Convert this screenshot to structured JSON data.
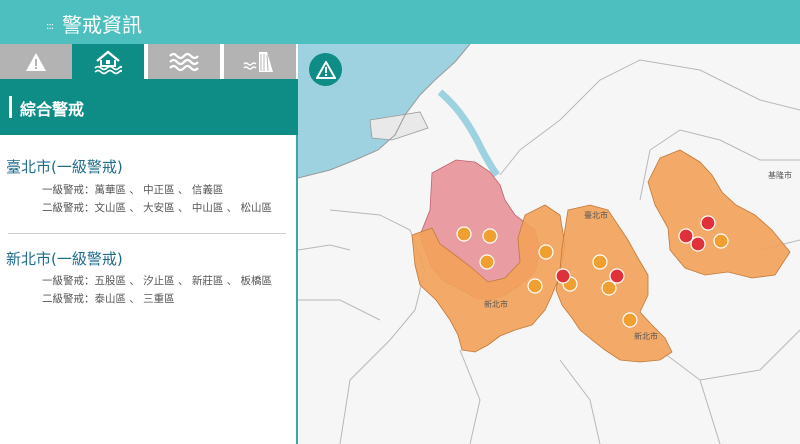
{
  "header": {
    "title": "警戒資訊",
    "menu_dots": ":::"
  },
  "tabs": [
    {
      "name": "alert",
      "icon": "warning-triangle-icon",
      "active": false
    },
    {
      "name": "flood",
      "icon": "flooded-house-icon",
      "active": true
    },
    {
      "name": "water",
      "icon": "water-waves-icon",
      "active": false
    },
    {
      "name": "reservoir",
      "icon": "dam-icon",
      "active": false
    }
  ],
  "section": {
    "title": "綜合警戒"
  },
  "cities": [
    {
      "name": "臺北市(一級警戒)",
      "level1": "一級警戒：萬華區 、 中正區 、 信義區",
      "level2": "二級警戒：文山區 、 大安區 、 中山區 、 松山區"
    },
    {
      "name": "新北市(一級警戒)",
      "level1": "一級警戒：五股區 、 汐止區 、 新莊區 、 板橋區",
      "level2": "二級警戒：泰山區 、 三重區"
    }
  ],
  "map": {
    "labels": {
      "taipei": "臺北市",
      "newtaipei_west": "新北市",
      "newtaipei_east": "新北市",
      "keelung": "基隆市"
    },
    "colors": {
      "level1": "#e8949a",
      "level2": "#f2a25a",
      "marker_orange": "#f0a030",
      "marker_red": "#e0303a",
      "sea": "#9ed2e0",
      "accent": "#0e8c86"
    },
    "alert_button_icon": "warning-triangle-icon"
  }
}
